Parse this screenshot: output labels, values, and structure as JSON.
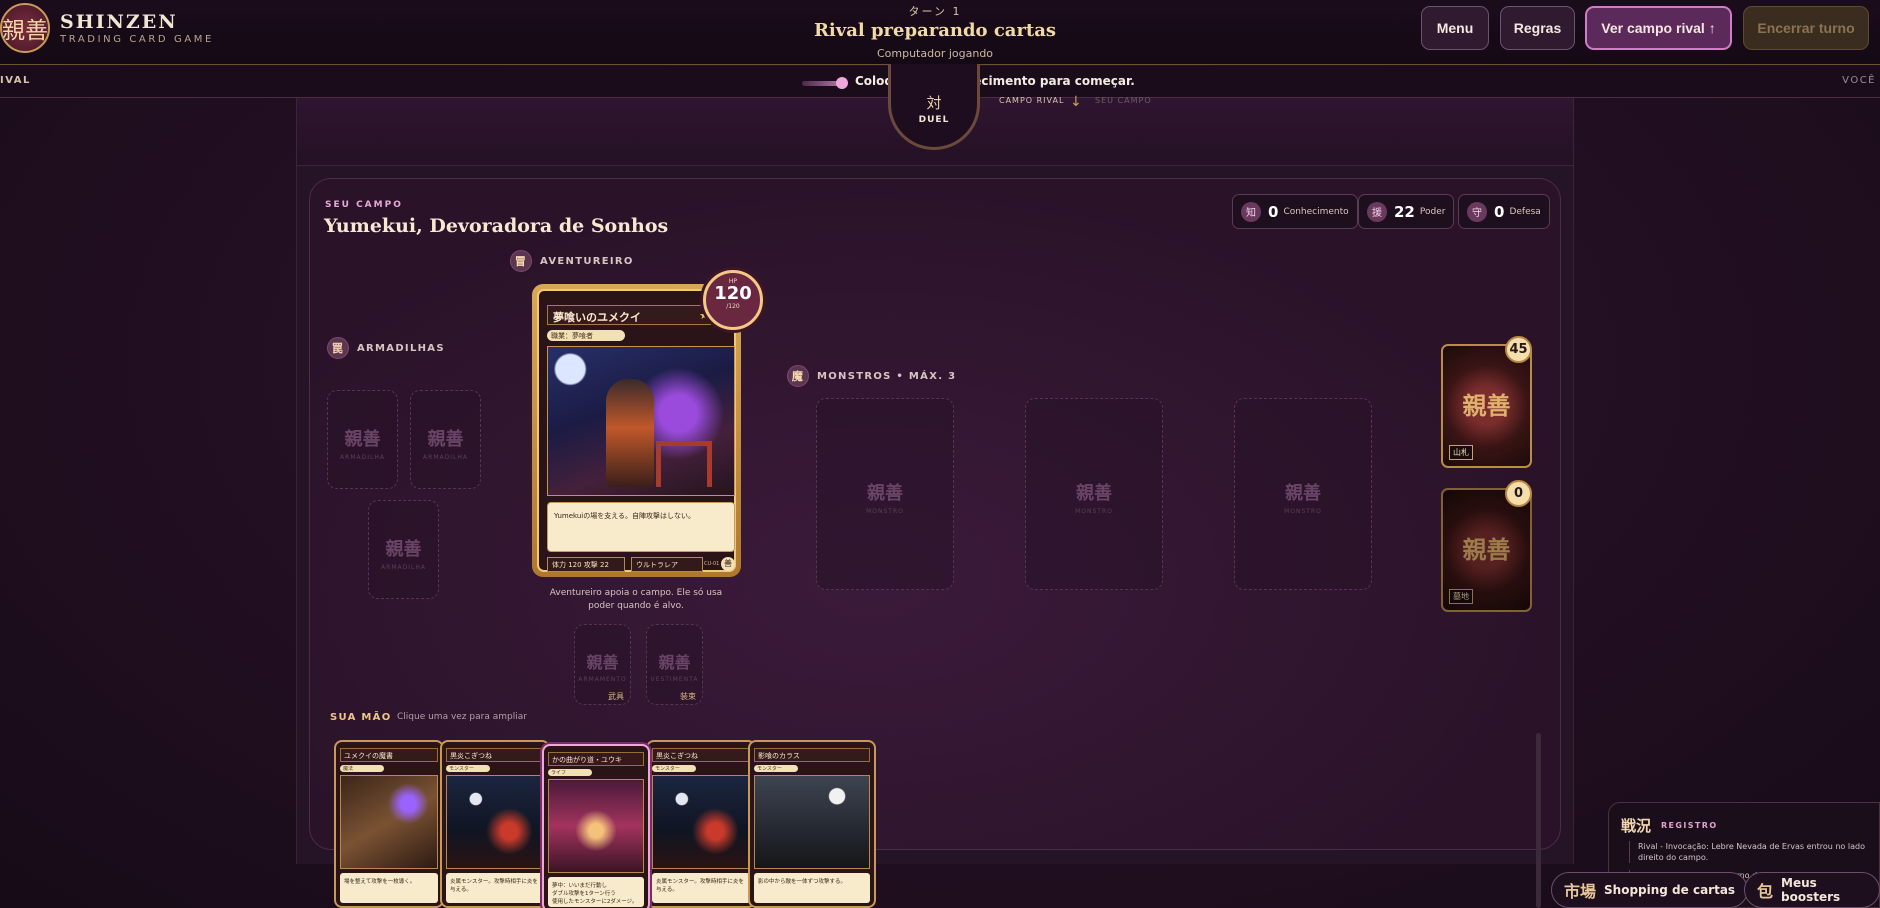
{
  "brand": {
    "seal": "親善",
    "name": "SHINZEN",
    "subtitle": "TRADING CARD GAME"
  },
  "turn": {
    "label": "ターン 1",
    "title": "Rival preparando cartas",
    "subtitle": "Computador jogando"
  },
  "header_buttons": {
    "menu": "Menu",
    "rules": "Regras",
    "view_rival": "Ver campo rival ↑",
    "end_turn": "Encerrar turno"
  },
  "status": {
    "left": "IVAL",
    "right": "VOCÊ",
    "message": "Coloque um Conhecimento para começar."
  },
  "duel": {
    "glyph": "対",
    "label": "DUEL",
    "field_rival": "CAMPO RIVAL",
    "field_self": "SEU CAMPO"
  },
  "player": {
    "kicker": "SEU CAMPO",
    "name": "Yumekui, Devoradora de Sonhos"
  },
  "stats": [
    {
      "icon": "知",
      "value": "0",
      "label": "Conhecimento"
    },
    {
      "icon": "援",
      "value": "22",
      "label": "Poder"
    },
    {
      "icon": "守",
      "value": "0",
      "label": "Defesa"
    }
  ],
  "sections": {
    "adventurer": {
      "icon": "冒",
      "label": "AVENTUREIRO"
    },
    "traps": {
      "icon": "罠",
      "label": "ARMADILHAS"
    },
    "monsters": {
      "icon": "魔",
      "label": "MONSTROS • MÁX. 3"
    }
  },
  "slots": {
    "seal": "親善",
    "trap": "ARMADILHA",
    "monster": "MONSTRO",
    "weapon": "ARMAMENTO",
    "weapon_jp": "武具",
    "outfit": "VESTIMENTA",
    "outfit_jp": "装束"
  },
  "adventurer_card": {
    "name": "夢喰いのユメクイ",
    "stars": "★",
    "tag": "職業：夢喰者",
    "text": "Yumekuiの場を支える。自陣攻撃はしない。",
    "stats": "体力 120   攻撃 22",
    "skill": "ウルトラレア",
    "code": "CU-01",
    "hp_label": "HP",
    "hp": "120",
    "hp_max": "/120"
  },
  "adventurer_note": "Aventureiro apoia o campo. Ele só usa poder quando é alvo.",
  "decks": [
    {
      "count": "45",
      "label": "山札"
    },
    {
      "count": "0",
      "label": "墓地"
    }
  ],
  "hand": {
    "label": "SUA MÃO",
    "hint": "Clique uma vez para ampliar",
    "cards": [
      {
        "name": "ユメクイの魔書",
        "tag": "魔法",
        "text": "場を整えて攻撃を一枚導く。",
        "art": "book"
      },
      {
        "name": "黒炎こぎつね",
        "tag": "モンスター",
        "text": "炎属モンスター。攻撃時相手に炎を与える。",
        "art": "cat"
      },
      {
        "name": "かの曲がり道・ユウキ",
        "tag": "ライフ",
        "text": "夢中：いいまだ行動し\nダブル攻撃を1ターン行う\n使用したモンスターに2ダメージ。",
        "art": "girl"
      },
      {
        "name": "黒炎こぎつね",
        "tag": "モンスター",
        "text": "炎属モンスター。攻撃時相手に炎を与える。",
        "art": "cat"
      },
      {
        "name": "影喰のカラス",
        "tag": "モンスター",
        "text": "影の中から敵を一体ずつ攻撃する。",
        "art": "crow"
      }
    ]
  },
  "log": {
    "title": "戦況",
    "subtitle": "REGISTRO",
    "entries": [
      "Rival - Invocação: Lebre Nevada de Ervas entrou no lado direito do campo.",
      "Rival - Preparação: Caderno da Trilha Nevada foi preparado."
    ]
  },
  "footer": {
    "shop_icon": "市場",
    "shop": "Shopping de cartas",
    "boosters_icon": "包",
    "boosters": "Meus boosters"
  },
  "colors": {
    "accent": "#d07cc7",
    "gold": "#c99a57",
    "bg": "#241024"
  }
}
